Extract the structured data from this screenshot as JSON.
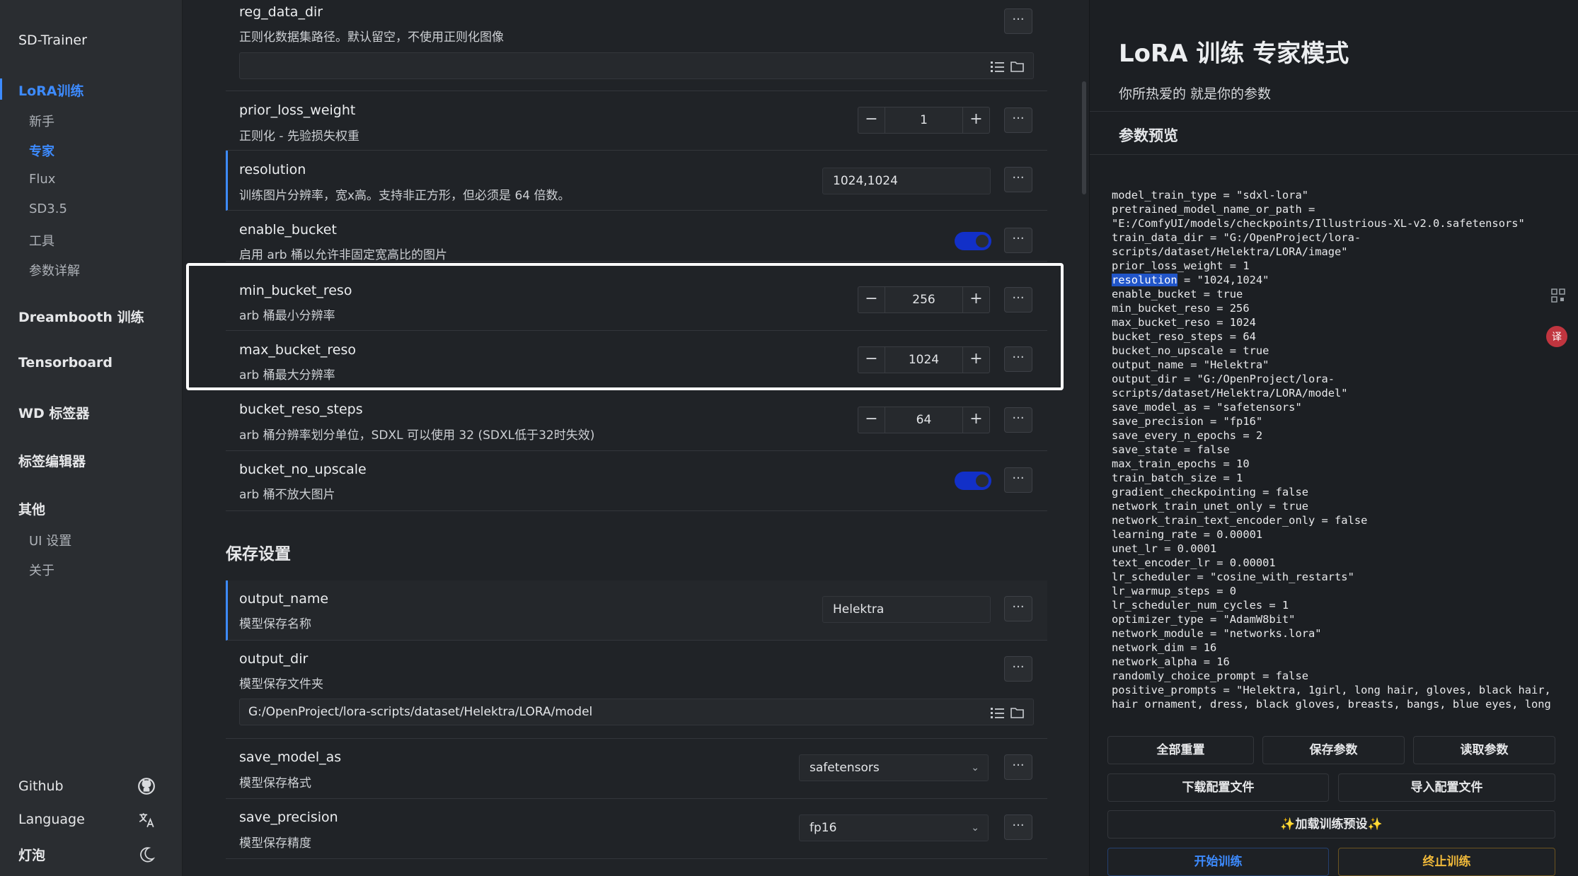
{
  "sidebar": {
    "brand": "SD-Trainer",
    "lora_head": "LoRA训练",
    "lora_items": [
      "新手",
      "专家",
      "Flux",
      "SD3.5",
      "工具",
      "参数详解"
    ],
    "dreambooth": "Dreambooth 训练",
    "tensorboard": "Tensorboard",
    "wd_tagger": "WD 标签器",
    "tag_editor": "标签编辑器",
    "other_head": "其他",
    "other_items": [
      "UI 设置",
      "关于"
    ],
    "github": "Github",
    "language": "Language",
    "lamp": "灯泡"
  },
  "form": {
    "reg_data_dir": {
      "name": "reg_data_dir",
      "desc": "正则化数据集路径。默认留空，不使用正则化图像",
      "value": ""
    },
    "prior_loss_weight": {
      "name": "prior_loss_weight",
      "desc": "正则化 - 先验损失权重",
      "value": "1"
    },
    "resolution": {
      "name": "resolution",
      "desc": "训练图片分辨率，宽x高。支持非正方形，但必须是 64 倍数。",
      "value": "1024,1024"
    },
    "enable_bucket": {
      "name": "enable_bucket",
      "desc": "启用 arb 桶以允许非固定宽高比的图片",
      "on": true
    },
    "min_bucket_reso": {
      "name": "min_bucket_reso",
      "desc": "arb 桶最小分辨率",
      "value": "256"
    },
    "max_bucket_reso": {
      "name": "max_bucket_reso",
      "desc": "arb 桶最大分辨率",
      "value": "1024"
    },
    "bucket_reso_steps": {
      "name": "bucket_reso_steps",
      "desc": "arb 桶分辨率划分单位，SDXL 可以使用 32 (SDXL低于32时失效)",
      "value": "64"
    },
    "bucket_no_upscale": {
      "name": "bucket_no_upscale",
      "desc": "arb 桶不放大图片",
      "on": true
    },
    "save_section": "保存设置",
    "output_name": {
      "name": "output_name",
      "desc": "模型保存名称",
      "value": "Helektra"
    },
    "output_dir": {
      "name": "output_dir",
      "desc": "模型保存文件夹",
      "value": "G:/OpenProject/lora-scripts/dataset/Helektra/LORA/model"
    },
    "save_model_as": {
      "name": "save_model_as",
      "desc": "模型保存格式",
      "value": "safetensors"
    },
    "save_precision": {
      "name": "save_precision",
      "desc": "模型保存精度",
      "value": "fp16"
    },
    "more_label": "···",
    "minus": "−",
    "plus": "+"
  },
  "panel": {
    "title": "LoRA 训练 专家模式",
    "subtitle": "你所热爱的 就是你的参数",
    "preview_title": "参数预览",
    "code_lines": [
      "model_train_type = \"sdxl-lora\"",
      "pretrained_model_name_or_path =",
      "\"E:/ComfyUI/models/checkpoints/Illustrious-XL-v2.0.safetensors\"",
      "train_data_dir = \"G:/OpenProject/lora-",
      "scripts/dataset/Helektra/LORA/image\"",
      "prior_loss_weight = 1",
      "RESOLUTION_LINE",
      "enable_bucket = true",
      "min_bucket_reso = 256",
      "max_bucket_reso = 1024",
      "bucket_reso_steps = 64",
      "bucket_no_upscale = true",
      "output_name = \"Helektra\"",
      "output_dir = \"G:/OpenProject/lora-",
      "scripts/dataset/Helektra/LORA/model\"",
      "save_model_as = \"safetensors\"",
      "save_precision = \"fp16\"",
      "save_every_n_epochs = 2",
      "save_state = false",
      "max_train_epochs = 10",
      "train_batch_size = 1",
      "gradient_checkpointing = false",
      "network_train_unet_only = true",
      "network_train_text_encoder_only = false",
      "learning_rate = 0.00001",
      "unet_lr = 0.0001",
      "text_encoder_lr = 0.00001",
      "lr_scheduler = \"cosine_with_restarts\"",
      "lr_warmup_steps = 0",
      "lr_scheduler_num_cycles = 1",
      "optimizer_type = \"AdamW8bit\"",
      "network_module = \"networks.lora\"",
      "network_dim = 16",
      "network_alpha = 16",
      "randomly_choice_prompt = false",
      "positive_prompts = \"Helektra, 1girl, long hair, gloves, black hair,",
      "hair ornament, dress, black gloves, breasts, bangs, blue eyes, long"
    ],
    "resolution_key": "resolution",
    "resolution_rest": " = \"1024,1024\"",
    "buttons": {
      "reset_all": "全部重置",
      "save_params": "保存参数",
      "load_params": "读取参数",
      "download_config": "下载配置文件",
      "import_config": "导入配置文件",
      "load_preset": "✨加载训练预设✨",
      "start": "开始训练",
      "stop": "终止训练"
    }
  },
  "colors": {
    "accent": "#3d8bff",
    "toggle_on": "#1230c8",
    "stop": "#f0b93a"
  }
}
